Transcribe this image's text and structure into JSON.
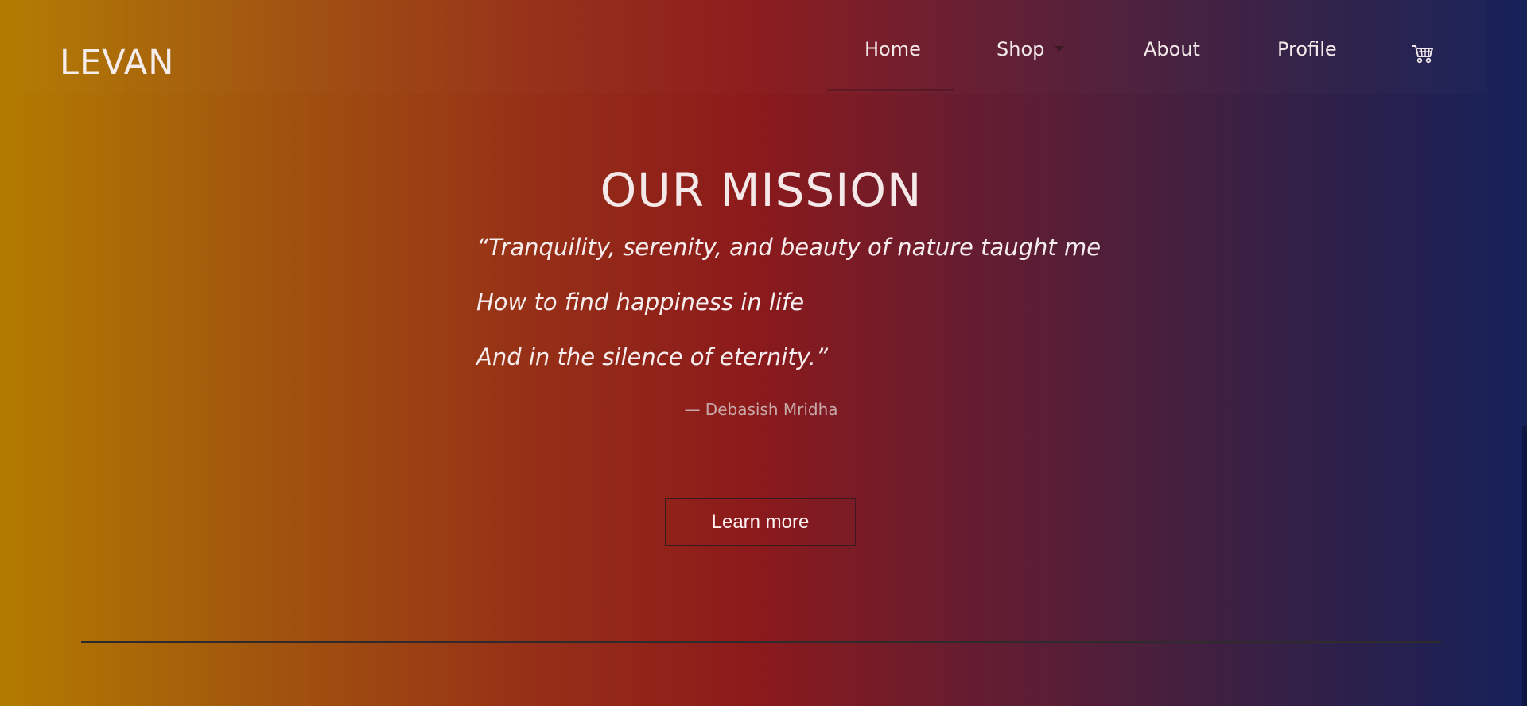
{
  "brand": {
    "logo_text": "LEVAN"
  },
  "nav": {
    "items": [
      {
        "label": "Home"
      },
      {
        "label": "Shop"
      },
      {
        "label": "About"
      },
      {
        "label": "Profile"
      }
    ],
    "cart_icon": "shopping-cart-icon",
    "shop_caret_icon": "chevron-down-icon"
  },
  "mission": {
    "title": "OUR MISSION",
    "quote_lines": [
      "“Tranquility, serenity, and beauty of nature taught me",
      "How to find happiness in life",
      "And in the silence of eternity.”"
    ],
    "author": "— Debasish Mridha",
    "button_label": "Learn more"
  },
  "colors": {
    "gradient_start": "#b37b00",
    "gradient_middle": "#8c1a1b",
    "gradient_end": "#16215a"
  }
}
